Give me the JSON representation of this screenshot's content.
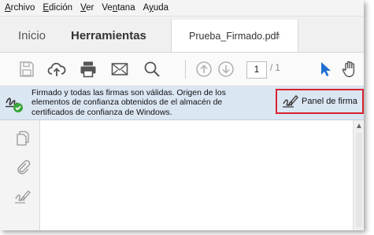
{
  "menubar": {
    "items": [
      {
        "pre": "",
        "mn": "A",
        "post": "rchivo"
      },
      {
        "pre": "",
        "mn": "E",
        "post": "dición"
      },
      {
        "pre": "",
        "mn": "V",
        "post": "er"
      },
      {
        "pre": "Ve",
        "mn": "n",
        "post": "tana"
      },
      {
        "pre": "A",
        "mn": "y",
        "post": "uda"
      }
    ]
  },
  "tabs": {
    "home": "Inicio",
    "tools": "Herramientas",
    "document": "Prueba_Firmado.pdf",
    "close": "×"
  },
  "toolbar": {
    "icons": [
      "save-icon",
      "cloud-upload-icon",
      "print-icon",
      "email-icon",
      "search-icon",
      "page-up-icon",
      "page-down-icon",
      "select-arrow-icon",
      "hand-tool-icon"
    ],
    "page_current": "1",
    "page_total": "/ 1"
  },
  "signature_bar": {
    "message_lines": [
      "Firmado y todas las firmas son válidas. Origen de los",
      "elementos de confianza obtenidos de el almacén de",
      "certificados de confianza de Windows."
    ],
    "panel_button": "Panel de firma",
    "highlight_color": "#d9232e"
  },
  "left_panel": {
    "icons": [
      "pages-icon",
      "attachment-icon",
      "signature-icon"
    ]
  },
  "colors": {
    "signature_bar_bg": "#dbe6f3",
    "accent_blue": "#1f6fd0",
    "valid_green": "#3aa63a"
  }
}
